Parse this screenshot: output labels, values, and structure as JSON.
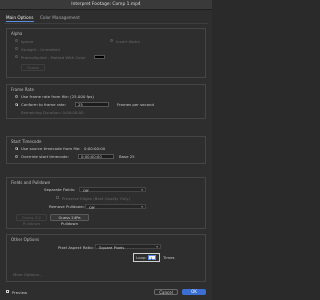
{
  "dialog": {
    "title": "Interpret Footage: Comp 1.mp4"
  },
  "tabs": [
    {
      "label": "Main Options"
    },
    {
      "label": "Color Management"
    }
  ],
  "alpha": {
    "header": "Alpha",
    "options": [
      "Ignore",
      "Invert Alpha",
      "Straight - Unmatted",
      "Premultiplied - Matted With Color"
    ],
    "guess_label": "Guess"
  },
  "frame_rate": {
    "header": "Frame Rate",
    "use_from_file_label": "Use frame rate from file: (25.000 fps)",
    "conform_label": "Conform to frame rate:",
    "conform_value": "25",
    "conform_unit": "Frames per second",
    "remaining_label": "Remaining Duration: 0:00:00:00"
  },
  "start_timecode": {
    "header": "Start Timecode",
    "use_source_label": "Use source timecode from file:",
    "use_source_value": "0:00:00:00",
    "override_label": "Override start timecode:",
    "override_value": "0:00:00:00",
    "base_label": "Base 25"
  },
  "fields_pulldown": {
    "header": "Fields and Pulldown",
    "separate_fields_label": "Separate Fields:",
    "separate_fields_value": "Off",
    "preserve_edges_label": "Preserve Edges (Best Quality Only)",
    "remove_pulldown_label": "Remove Pulldown:",
    "remove_pulldown_value": "Off",
    "guess_3_2_label": "Guess 3:2 Pulldown",
    "guess_24pa_label": "Guess 24Pa Pulldown"
  },
  "other_options": {
    "header": "Other Options",
    "pixel_aspect_label": "Pixel Aspect Ratio:",
    "pixel_aspect_value": "Square Pixels",
    "loop_label": "Loop:",
    "loop_value": "1",
    "times_label": "Times",
    "more_options_label": "More Options..."
  },
  "footer": {
    "preview_label": "Preview",
    "cancel_label": "Cancel",
    "ok_label": "OK"
  },
  "colors": {
    "accent": "#5a8de0",
    "background": "#2e2e2e"
  }
}
